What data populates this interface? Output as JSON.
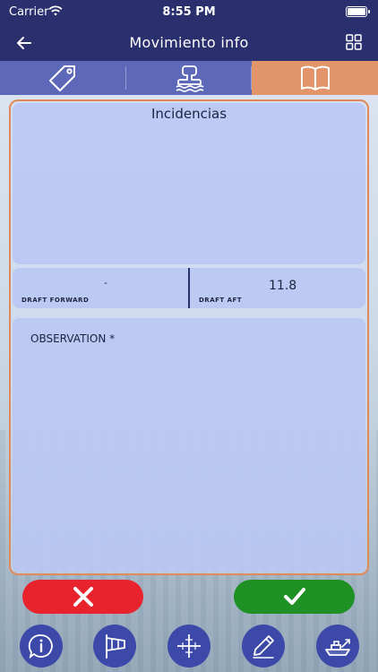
{
  "status": {
    "carrier": "Carrier",
    "time": "8:55 PM"
  },
  "nav": {
    "title": "Movimiento info"
  },
  "tabs": [
    {
      "icon": "tag-icon",
      "active": false
    },
    {
      "icon": "stamp-icon",
      "active": false
    },
    {
      "icon": "book-icon",
      "active": true
    }
  ],
  "incidencias": {
    "title": "Incidencias"
  },
  "draft": {
    "forward_label": "DRAFT FORWARD",
    "forward_value": "-",
    "aft_label": "DRAFT AFT",
    "aft_value": "11.8"
  },
  "observation": {
    "label": "OBSERVATION *"
  },
  "colors": {
    "header": "#2a2f6e",
    "tabbar": "#5d69b8",
    "active_tab": "#e2956a",
    "border": "#e08a5b",
    "cancel": "#e8232d",
    "confirm": "#1f9124",
    "bottom_icon_bg": "#3d49a8"
  },
  "bottom_icons": [
    "info-icon",
    "windsock-icon",
    "crosshair-icon",
    "pen-icon",
    "tugboat-icon"
  ]
}
